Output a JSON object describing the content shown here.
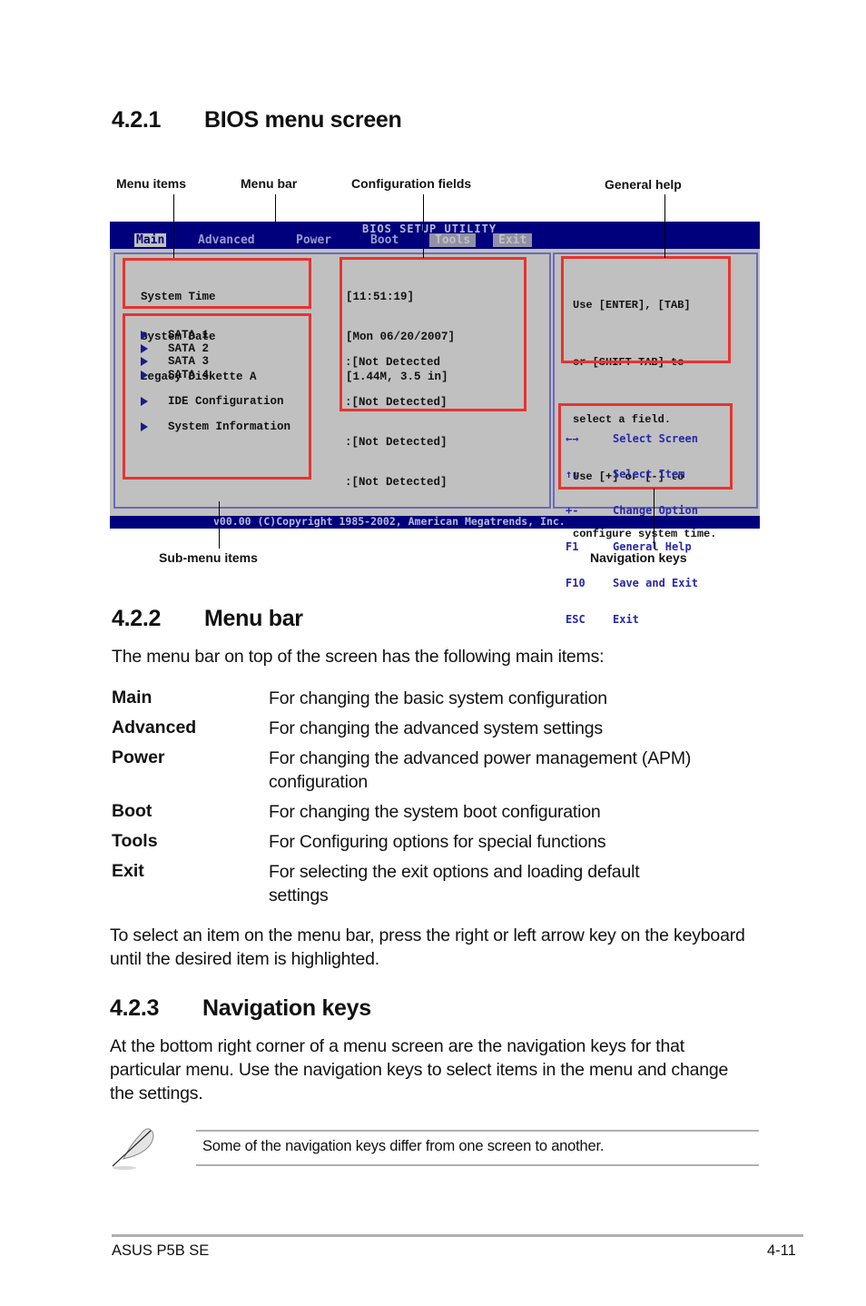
{
  "sections": {
    "s1": {
      "num": "4.2.1",
      "title": "BIOS menu screen"
    },
    "s2": {
      "num": "4.2.2",
      "title": "Menu bar",
      "intro": "The menu bar on top of the screen has the following main items:"
    },
    "s3": {
      "num": "4.2.3",
      "title": "Navigation keys"
    }
  },
  "callouts": {
    "menu_items": "Menu items",
    "menu_bar": "Menu bar",
    "config_fields": "Configuration fields",
    "general_help": "General help",
    "submenu_items": "Sub-menu items",
    "navigation_keys": "Navigation keys"
  },
  "bios": {
    "title": "BIOS SETUP UTILITY",
    "menu": [
      "Main",
      "Advanced",
      "Power",
      "Boot",
      "Tools",
      "Exit"
    ],
    "active_menu": "Main",
    "items": [
      "System Time",
      "System Date",
      "Legacy Diskette A"
    ],
    "submenus": [
      "SATA 1",
      "SATA 2",
      "SATA 3",
      "SATA 4",
      "IDE Configuration",
      "System Information"
    ],
    "values": [
      "[11:51:19]",
      "[Mon 06/20/2007]",
      "[1.44M, 3.5 in]"
    ],
    "sata_values": [
      ":[Not Detected",
      ":[Not Detected]",
      ":[Not Detected]",
      ":[Not Detected]"
    ],
    "help": [
      "Use [ENTER], [TAB]",
      "or [SHIFT-TAB] to",
      "select a field.",
      "Use [+] or [-] to",
      "configure system time."
    ],
    "nav_keys": [
      {
        "key": "←→",
        "action": "Select Screen"
      },
      {
        "key": "↑↓",
        "action": "Select Item"
      },
      {
        "key": "+-",
        "action": "Change Option"
      },
      {
        "key": "F1",
        "action": "General Help"
      },
      {
        "key": "F10",
        "action": "Save and Exit"
      },
      {
        "key": "ESC",
        "action": "Exit"
      }
    ],
    "copyright": "v00.00 (C)Copyright 1985-2002, American Megatrends, Inc.",
    "colors": {
      "bar": "#00007c",
      "panel": "#c0c0c0",
      "highlight": "#e8332e",
      "nav_text": "#2828a8"
    }
  },
  "menu_defs": [
    {
      "term": "Main",
      "desc": "For changing the basic system configuration"
    },
    {
      "term": "Advanced",
      "desc": "For changing the advanced system settings"
    },
    {
      "term": "Power",
      "desc": "For changing the advanced power management (APM) configuration"
    },
    {
      "term": "Boot",
      "desc": "For changing the system boot configuration"
    },
    {
      "term": "Tools",
      "desc": "For Configuring options for special functions"
    },
    {
      "term": "Exit",
      "desc": "For selecting the exit options and loading default settings"
    }
  ],
  "menu_bar_paragraph": "To select an item on the menu bar, press the right or left arrow key on the keyboard until the desired item is highlighted.",
  "nav_paragraph": "At the bottom right corner of a menu screen are the navigation keys for that particular menu. Use the navigation keys to select items in the menu and change the settings.",
  "note": {
    "icon": "feather-pen-icon",
    "text": "Some of the navigation keys differ from one screen to another."
  },
  "footer": {
    "left": "ASUS P5B SE",
    "right": "4-11"
  }
}
